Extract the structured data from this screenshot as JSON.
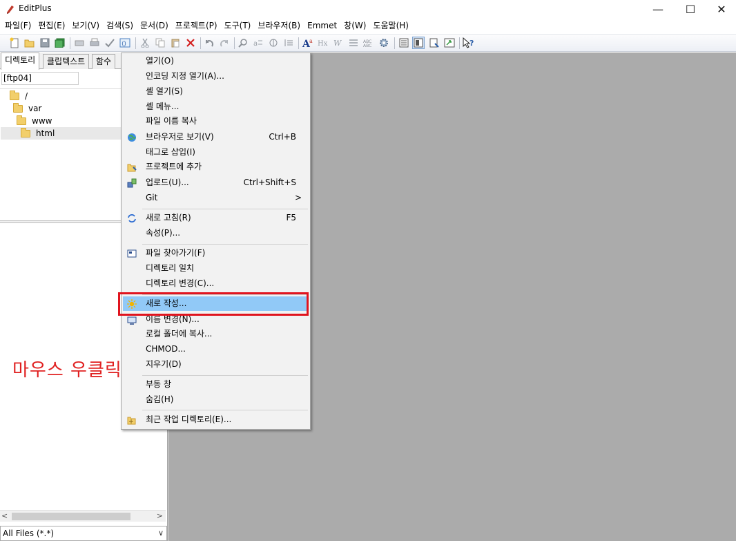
{
  "window": {
    "title": "EditPlus",
    "minimize": "—",
    "maximize": "☐",
    "close": "✕"
  },
  "menubar": [
    "파일(F)",
    "편집(E)",
    "보기(V)",
    "검색(S)",
    "문서(D)",
    "프로젝트(P)",
    "도구(T)",
    "브라우저(B)",
    "Emmet",
    "창(W)",
    "도움말(H)"
  ],
  "toolbar": {
    "icons": [
      "new-file-icon",
      "open-folder-icon",
      "save-icon",
      "save-all-icon",
      "print-preview-icon",
      "print-icon",
      "spellcheck-icon",
      "html-preview-icon",
      "cut-icon",
      "copy-icon",
      "paste-icon",
      "delete-icon",
      "undo-icon",
      "redo-icon",
      "find-icon",
      "replace-icon",
      "goto-icon",
      "indent-icon",
      "font-icon",
      "hx-icon",
      "word-wrap-icon",
      "line-number-icon",
      "column-icon",
      "settings-icon",
      "directory-window-icon",
      "output-window-icon",
      "cliptext-icon",
      "fullscreen-icon",
      "context-help-icon"
    ]
  },
  "leftpanel": {
    "tabs": [
      "디렉토리",
      "클립텍스트",
      "함수"
    ],
    "path": "[ftp04]",
    "tree": [
      "/",
      "var",
      "www",
      "html"
    ],
    "hscroll_left": "<",
    "hscroll_right": ">",
    "filter": "All Files (*.*)",
    "filter_arrow": "∨"
  },
  "annotation": "마우스 우클릭",
  "context_menu": {
    "items": [
      {
        "label": "열기(O)",
        "shortcut": "",
        "icon": ""
      },
      {
        "label": "인코딩 지정 열기(A)...",
        "shortcut": "",
        "icon": ""
      },
      {
        "label": "셸 열기(S)",
        "shortcut": "",
        "icon": ""
      },
      {
        "label": "셸 메뉴...",
        "shortcut": "",
        "icon": ""
      },
      {
        "label": "파일 이름 복사",
        "shortcut": "",
        "icon": ""
      },
      {
        "label": "브라우저로 보기(V)",
        "shortcut": "Ctrl+B",
        "icon": "globe-icon"
      },
      {
        "label": "태그로 삽입(I)",
        "shortcut": "",
        "icon": ""
      },
      {
        "label": "프로젝트에 추가",
        "shortcut": "",
        "icon": "project-add-icon"
      },
      {
        "label": "업로드(U)...",
        "shortcut": "Ctrl+Shift+S",
        "icon": "upload-icon"
      },
      {
        "label": "Git",
        "shortcut": ">",
        "icon": ""
      },
      {
        "label": "새로 고침(R)",
        "shortcut": "F5",
        "icon": "refresh-icon"
      },
      {
        "label": "속성(P)...",
        "shortcut": "",
        "icon": ""
      },
      {
        "label": "파일 찾아가기(F)",
        "shortcut": "",
        "icon": "file-goto-icon"
      },
      {
        "label": "디렉토리 일치",
        "shortcut": "",
        "icon": ""
      },
      {
        "label": "디렉토리 변경(C)...",
        "shortcut": "",
        "icon": ""
      },
      {
        "label": "새로 작성...",
        "shortcut": "",
        "icon": "new-sparkle-icon"
      },
      {
        "label": "이름 변경(N)...",
        "shortcut": "",
        "icon": "rename-icon"
      },
      {
        "label": "로컬 폴더에 복사...",
        "shortcut": "",
        "icon": ""
      },
      {
        "label": "CHMOD...",
        "shortcut": "",
        "icon": ""
      },
      {
        "label": "지우기(D)",
        "shortcut": "",
        "icon": ""
      },
      {
        "label": "부동 창",
        "shortcut": "",
        "icon": ""
      },
      {
        "label": "숨김(H)",
        "shortcut": "",
        "icon": ""
      },
      {
        "label": "최근 작업 디렉토리(E)...",
        "shortcut": "",
        "icon": "recent-folder-icon"
      }
    ],
    "highlighted": "새로 작성..."
  }
}
